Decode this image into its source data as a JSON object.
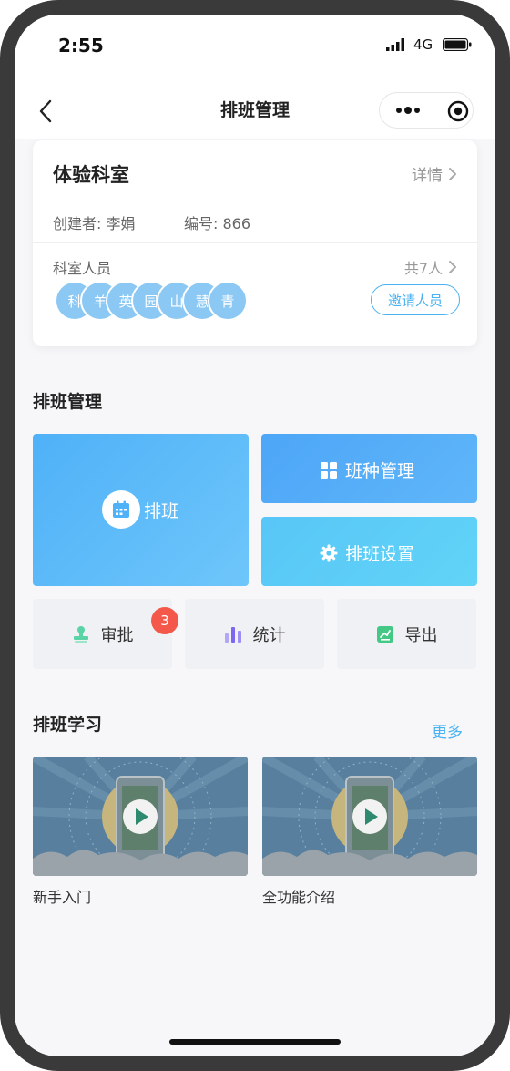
{
  "status_bar": {
    "time": "2:55",
    "network": "4G"
  },
  "nav": {
    "title": "排班管理"
  },
  "department": {
    "name": "体验科室",
    "detail_label": "详情",
    "creator": "创建者: 李娟",
    "number": "编号: 866",
    "members_label": "科室人员",
    "members_count": "共7人",
    "avatars": [
      "科",
      "羊",
      "英",
      "园",
      "山",
      "慧",
      "青"
    ],
    "invite_label": "邀请人员"
  },
  "schedule_section": {
    "title": "排班管理",
    "schedule_label": "排班",
    "shift_label": "班种管理",
    "settings_label": "排班设置",
    "approve_label": "审批",
    "approve_badge": "3",
    "stats_label": "统计",
    "export_label": "导出"
  },
  "learning_section": {
    "title": "排班学习",
    "more_label": "更多",
    "videos": [
      {
        "title": "新手入门"
      },
      {
        "title": "全功能介绍"
      }
    ]
  },
  "colors": {
    "accent": "#49b2f0",
    "badge": "#f4584b",
    "avatar": "#8cc8f4"
  }
}
